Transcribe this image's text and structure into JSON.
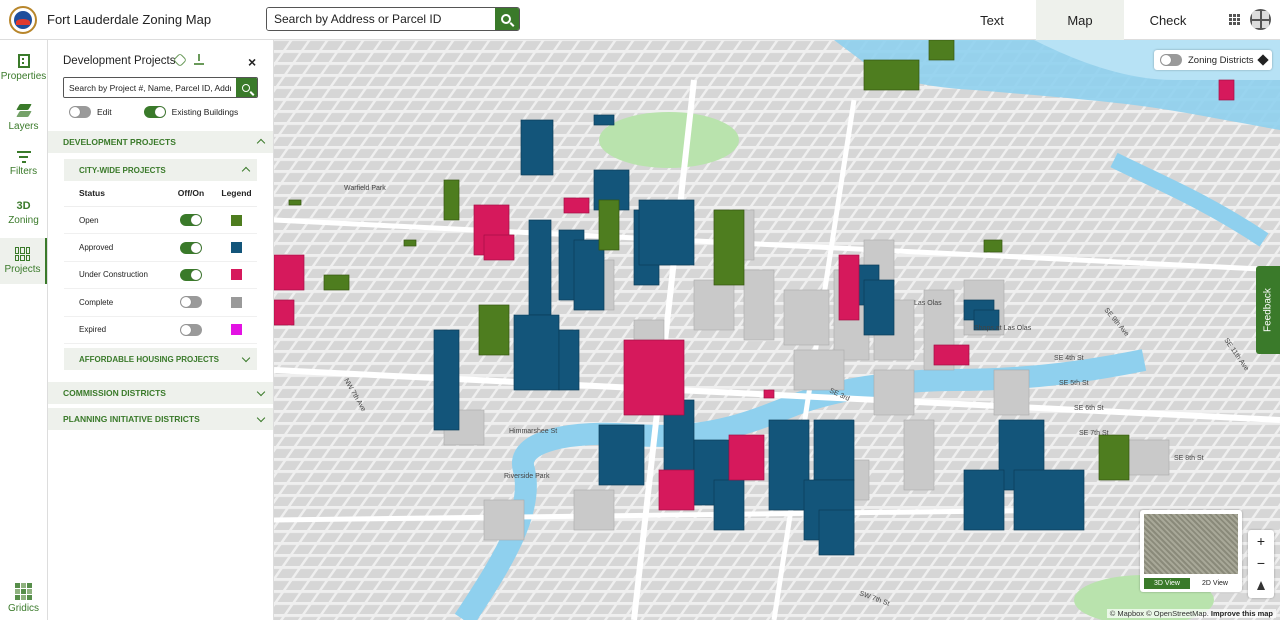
{
  "app": {
    "title": "Fort Lauderdale Zoning Map"
  },
  "top_search": {
    "placeholder": "Search by Address or Parcel ID"
  },
  "top_nav": [
    {
      "label": "Text"
    },
    {
      "label": "Map",
      "active": true
    },
    {
      "label": "Check"
    }
  ],
  "rail": [
    {
      "label": "Properties",
      "icon": "building-icon"
    },
    {
      "label": "Layers",
      "icon": "layers-icon"
    },
    {
      "label": "Filters",
      "icon": "filter-icon"
    },
    {
      "label": "Zoning",
      "icon": "3d-icon",
      "icon_text": "3D"
    },
    {
      "label": "Projects",
      "icon": "projects-grid-icon",
      "active": true
    },
    {
      "label": "Gridics",
      "icon": "gridics-logo-icon"
    }
  ],
  "panel": {
    "title": "Development Projects",
    "search_placeholder": "Search by Project #, Name, Parcel ID, Address",
    "edit_label": "Edit",
    "existing_buildings_label": "Existing Buildings",
    "section_dev": "DEVELOPMENT PROJECTS",
    "sub_citywide": "CITY-WIDE PROJECTS",
    "table_headers": {
      "status": "Status",
      "offon": "Off/On",
      "legend": "Legend"
    },
    "rows": [
      {
        "status": "Open",
        "on": true,
        "color": "#4e7d1f"
      },
      {
        "status": "Approved",
        "on": true,
        "color": "#13557a"
      },
      {
        "status": "Under Construction",
        "on": true,
        "color": "#d6195c"
      },
      {
        "status": "Complete",
        "on": false,
        "color": "#9a9a9a"
      },
      {
        "status": "Expired",
        "on": false,
        "color": "#e312e3"
      }
    ],
    "sub_affordable": "AFFORDABLE HOUSING PROJECTS",
    "section_commission": "COMMISSION DISTRICTS",
    "section_planning": "PLANNING INITIATIVE DISTRICTS"
  },
  "map": {
    "zoning_toggle_label": "Zoning Districts",
    "feedback_label": "Feedback",
    "view_3d": "3D View",
    "view_2d": "2D View",
    "zoom_in": "+",
    "zoom_out": "−",
    "attribution_prefix": "© Mapbox © OpenStreetMap.",
    "attribution_link": "Improve this map",
    "labels": [
      "Warfield Park",
      "NW 7th Ave",
      "Himmarshee St",
      "SE 3rd",
      "Riverside Park",
      "SW 7th St",
      "SE 4th St",
      "SE 5th St",
      "SE 6th St",
      "SE 7th St",
      "SE 8th St",
      "Las Olas",
      "Shops at Las Olas",
      "SE 9th Ave",
      "SE 11th Ave"
    ]
  }
}
